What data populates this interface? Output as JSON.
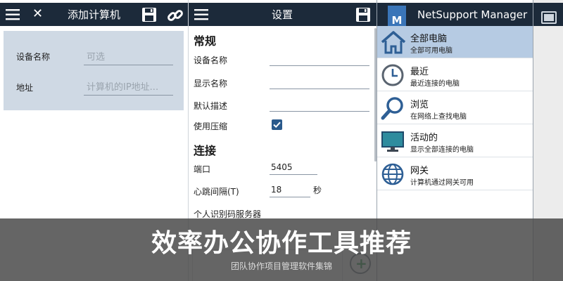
{
  "panel_add": {
    "title": "添加计算机",
    "fields": [
      {
        "label": "设备名称",
        "placeholder": "可选"
      },
      {
        "label": "地址",
        "placeholder": "计算机的IP地址..."
      }
    ]
  },
  "panel_settings": {
    "title": "设置",
    "general_heading": "常规",
    "device_name_label": "设备名称",
    "display_name_label": "显示名称",
    "default_desc_label": "默认描述",
    "compression_label": "使用压缩",
    "compression_checked": true,
    "connection_heading": "连接",
    "port_label": "端口",
    "port_value": "5405",
    "heartbeat_label": "心跳间隔(T)",
    "heartbeat_value": "18",
    "heartbeat_unit": "秒",
    "pin_server_label": "个人识别码服务器"
  },
  "panel_netsupport": {
    "logo_letter": "M",
    "title": "NetSupport Manager",
    "items": [
      {
        "title": "全部电脑",
        "subtitle": "全部可用电脑",
        "icon": "home-icon",
        "active": true
      },
      {
        "title": "最近",
        "subtitle": "最近连接的电脑",
        "icon": "clock-icon",
        "active": false
      },
      {
        "title": "浏览",
        "subtitle": "在网络上查找电脑",
        "icon": "magnifier-icon",
        "active": false
      },
      {
        "title": "活动的",
        "subtitle": "显示全部连接的电脑",
        "icon": "monitor-icon",
        "active": false
      },
      {
        "title": "网关",
        "subtitle": "计算机通过网关可用",
        "icon": "globe-icon",
        "active": false
      }
    ]
  },
  "overlay": {
    "headline": "效率办公协作工具推荐",
    "subtitle": "团队协作项目管理软件集锦"
  },
  "colors": {
    "toolbar": "#1c2a3a",
    "card": "#cfd9e4",
    "active_item": "#b6cbe3",
    "accent": "#2a5a8c"
  }
}
